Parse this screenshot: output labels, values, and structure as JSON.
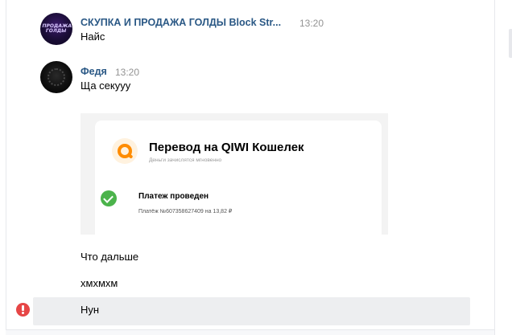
{
  "messages": [
    {
      "author": "СКУПКА И ПРОДАЖА ГОЛДЫ Block Str...",
      "time": "13:20",
      "text": "Найс",
      "avatar_text": "ПРОДАЖА ГОЛДЫ",
      "avatar": "group-avatar"
    },
    {
      "author": "Федя",
      "time": "13:20",
      "text": "Ща секууу",
      "avatar": "user-avatar",
      "attachment": {
        "icon": "qiwi-logo-icon",
        "title": "Перевод на QIWI Кошелек",
        "subtitle": "Деньги зачислятся мгновенно",
        "status_icon": "check-icon",
        "status": "Платеж проведен",
        "detail": "Платёж №607358627409 на 13,82 ₽"
      }
    }
  ],
  "follow_up": [
    {
      "text": "Что дальше"
    },
    {
      "text": "хмхмхм"
    },
    {
      "text": "Нун",
      "status_icon": "error-icon",
      "selected": true
    }
  ],
  "colors": {
    "author": "#2a5885",
    "time": "#939393",
    "selected_row": "#edeef0",
    "error": "#e64646",
    "success": "#4bb34b",
    "qiwi_orange": "#ff8c00"
  }
}
